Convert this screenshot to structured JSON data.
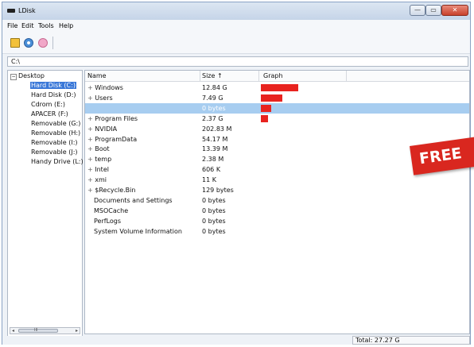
{
  "window": {
    "title": "LDisk",
    "controls": {
      "minimize": "—",
      "maximize": "▭",
      "close": "✕"
    }
  },
  "menu": [
    "File",
    "Edit",
    "Tools",
    "Help"
  ],
  "toolbar": {
    "icons": [
      "open-folder-icon",
      "refresh-icon",
      "stop-icon"
    ]
  },
  "path": "C:\\",
  "tree": {
    "root": "Desktop",
    "items": [
      {
        "label": "Hard Disk (C:)",
        "selected": true
      },
      {
        "label": "Hard Disk (D:)"
      },
      {
        "label": "Cdrom (E:)"
      },
      {
        "label": "APACER (F:)"
      },
      {
        "label": "Removable (G:)"
      },
      {
        "label": "Removable (H:)"
      },
      {
        "label": "Removable (I:)"
      },
      {
        "label": "Removable (J:)"
      },
      {
        "label": "Handy Drive (L:)"
      }
    ],
    "scroll_label": "III"
  },
  "list": {
    "columns": {
      "name": "Name",
      "size": "Size",
      "sort_arrow": "↑",
      "graph": "Graph"
    },
    "rows": [
      {
        "name": "Windows",
        "size": "12.84 G",
        "expandable": true,
        "graph": 0.47
      },
      {
        "name": "Users",
        "size": "7.49 G",
        "expandable": true,
        "graph": 0.27
      },
      {
        "name": "",
        "size": "0 bytes",
        "expandable": false,
        "selected": true,
        "graph": 0.13
      },
      {
        "name": "Program Files",
        "size": "2.37 G",
        "expandable": true,
        "graph": 0.09
      },
      {
        "name": "NVIDIA",
        "size": "202.83 M",
        "expandable": true
      },
      {
        "name": "ProgramData",
        "size": "54.17 M",
        "expandable": true
      },
      {
        "name": "Boot",
        "size": "13.39 M",
        "expandable": true
      },
      {
        "name": "temp",
        "size": "2.38 M",
        "expandable": true
      },
      {
        "name": "Intel",
        "size": "606 K",
        "expandable": true
      },
      {
        "name": "xmi",
        "size": "11 K",
        "expandable": true
      },
      {
        "name": "$Recycle.Bin",
        "size": "129 bytes",
        "expandable": true
      },
      {
        "name": "Documents and Settings",
        "size": "0 bytes",
        "expandable": false
      },
      {
        "name": "MSOCache",
        "size": "0 bytes",
        "expandable": false
      },
      {
        "name": "PerfLogs",
        "size": "0 bytes",
        "expandable": false
      },
      {
        "name": "System Volume Information",
        "size": "0 bytes",
        "expandable": false
      }
    ]
  },
  "status": {
    "total": "Total: 27.27 G"
  },
  "overlay": {
    "free_text": "FREE"
  },
  "colors": {
    "bar": "#e8231f",
    "selection": "#3a78d8",
    "row_selection": "#a7cdf0",
    "banner": "#d9271f"
  }
}
